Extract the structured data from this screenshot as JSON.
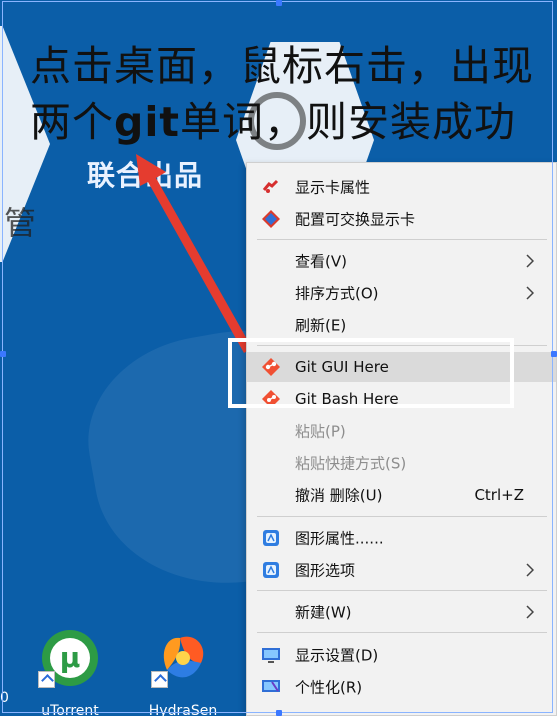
{
  "caption": {
    "line1": "点击桌面，鼠标右击，出现",
    "line2_prefix": "两个",
    "line2_git": "git",
    "line2_suffix": "单词，则安装成功"
  },
  "wallpaper": {
    "center_text": "联合出品",
    "left_partial_glyph": "管"
  },
  "context_menu": {
    "items": [
      {
        "id": "graphics-properties",
        "label": "显示卡属性",
        "icon": "graphics-card-icon"
      },
      {
        "id": "switchable-graphics",
        "label": "配置可交换显示卡",
        "icon": "switchable-graphics-icon"
      },
      {
        "id": "view",
        "label": "查看(V)",
        "has_submenu": true
      },
      {
        "id": "sort-by",
        "label": "排序方式(O)",
        "has_submenu": true
      },
      {
        "id": "refresh",
        "label": "刷新(E)"
      },
      {
        "id": "git-gui-here",
        "label": "Git GUI Here",
        "icon": "git-gui-icon"
      },
      {
        "id": "git-bash-here",
        "label": "Git Bash Here",
        "icon": "git-bash-icon"
      },
      {
        "id": "paste",
        "label": "粘贴(P)",
        "disabled": true
      },
      {
        "id": "paste-shortcut",
        "label": "粘贴快捷方式(S)",
        "disabled": true
      },
      {
        "id": "undo-delete",
        "label": "撤消 删除(U)",
        "shortcut": "Ctrl+Z"
      },
      {
        "id": "graphics-properties-2",
        "label": "图形属性......",
        "icon": "intel-graphics-icon"
      },
      {
        "id": "graphics-options",
        "label": "图形选项",
        "icon": "intel-graphics-options-icon",
        "has_submenu": true
      },
      {
        "id": "new",
        "label": "新建(W)",
        "has_submenu": true
      },
      {
        "id": "display-settings",
        "label": "显示设置(D)",
        "icon": "display-settings-icon"
      },
      {
        "id": "personalize",
        "label": "个性化(R)",
        "icon": "personalize-icon"
      }
    ]
  },
  "desktop_icons": {
    "utorrent": "uTorrent",
    "hydrasen": "HydraSen",
    "left_edge": "0"
  },
  "colors": {
    "desktop_blue": "#0b5ea8",
    "menu_bg": "#f2f2f2",
    "arrow_red": "#e53c2f",
    "highlight_white": "#ffffff"
  }
}
